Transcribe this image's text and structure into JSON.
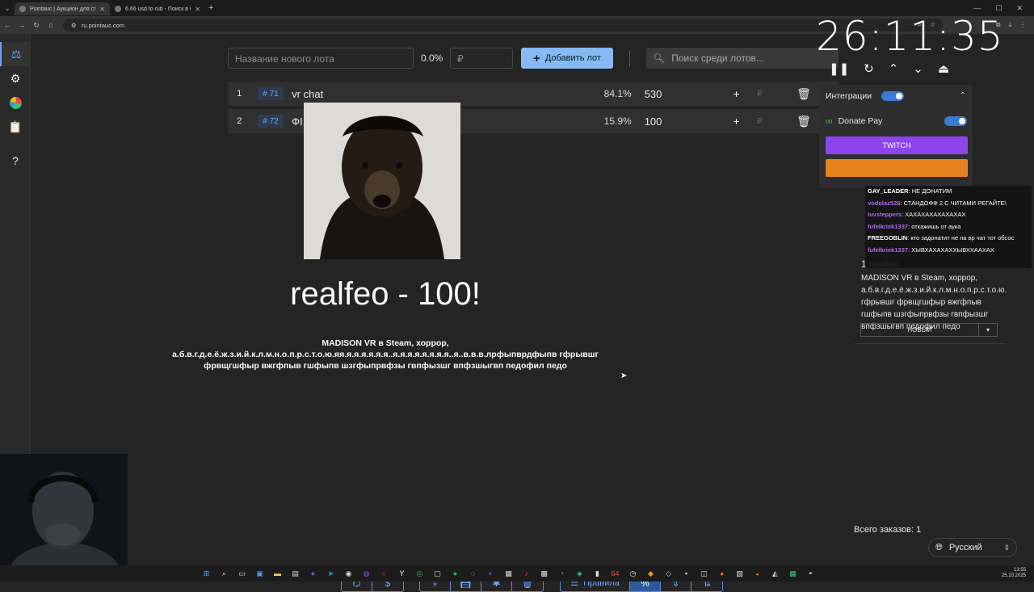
{
  "browser": {
    "tabs": [
      {
        "title": "Pointauc | Аукцион для стрима",
        "active": true
      },
      {
        "title": "6.66 usd to rub - Поиск в Google",
        "active": false
      }
    ],
    "url": "ru.pointauc.com"
  },
  "sidebar": {
    "items": [
      {
        "icon": "gavel-icon",
        "active": true
      },
      {
        "icon": "gear-icon",
        "active": false
      },
      {
        "icon": "pie-chart-icon",
        "active": false
      },
      {
        "icon": "clipboard-icon",
        "active": false
      },
      {
        "icon": "help-icon",
        "active": false
      }
    ]
  },
  "toolbar": {
    "new_lot_placeholder": "Название нового лота",
    "percent": "0.0%",
    "price_placeholder": "₽",
    "add_lot_label": "Добавить лот",
    "search_placeholder": "Поиск среди лотов..."
  },
  "lots": [
    {
      "index": "1",
      "id": "# 71",
      "name": "vr chat",
      "percent": "84.1%",
      "amount": "530"
    },
    {
      "index": "2",
      "id": "# 72",
      "name": "ФІ",
      "percent": "15.9%",
      "amount": "100"
    }
  ],
  "winner": {
    "text": "realfeo - 100!",
    "description": "MADISON VR в Steam, хоррор, а.б.в.г.д.е.ё.ж.з.и.й.к.л.м.н.о.п.р.с.т.о.ю.яя.я.я.я.я.я.я..я.я.я.я.я.я.я.я..я..в.в.в.лрфыпврдфыпв гфрывшг фрвщгшфыр вжгфпыв гшфыпв шзгфыпрвфзы гвпфызшг впфзшыгвп педофил педо"
  },
  "timer": {
    "display": "26:11:35"
  },
  "integrations": {
    "title": "Интеграции",
    "donate_pay_label": "Donate Pay",
    "twitch_label": "TWITCH"
  },
  "chat": [
    {
      "user": "GAY_LEADER",
      "color": "#ffffff",
      "message": "НЕ ДОНАТИМ"
    },
    {
      "user": "vodolaz526",
      "color": "#b06af0",
      "message": "СТАНДОФФ 2 С ЧИТАМИ РЕГАЙТЕ\\"
    },
    {
      "user": "luvsteppers",
      "color": "#b06af0",
      "message": "ХАХАХАХАХАХАХАХ"
    },
    {
      "user": "fufelkriek1337",
      "color": "#b06af0",
      "message": "откажишь от аука"
    },
    {
      "user": "FREEGOBLIN",
      "color": "#ffffff",
      "message": "кто задонатит не на вр чат тот обсос"
    },
    {
      "user": "fufelkriek1337",
      "color": "#b06af0",
      "message": "ХЫВХАХАХАХХЫВХХААХАХ"
    }
  ],
  "order_card": {
    "title": "1 realfeo",
    "text": "MADISON VR в Steam, хоррор, а.б.в.г.д.е.ё.ж.з.и.й.к.л.м.н.о.п.р.с.т.о.ю. гфрывшг фрвщгшфыр вжгфпыв гшфыпв шзгфыпрвфзы гвпфызшг впфзшыгвп педофил педо",
    "status": "НОВЫЙ"
  },
  "footer": {
    "orders_total": "Всего заказов: 1",
    "language": "Русский",
    "rules_label": "Правила"
  },
  "taskbar": {
    "time": "13:55",
    "date": "25.10.2025"
  },
  "colors": {
    "accent": "#86baf3",
    "twitch": "#8e44ec",
    "donate_orange": "#e8821e"
  }
}
